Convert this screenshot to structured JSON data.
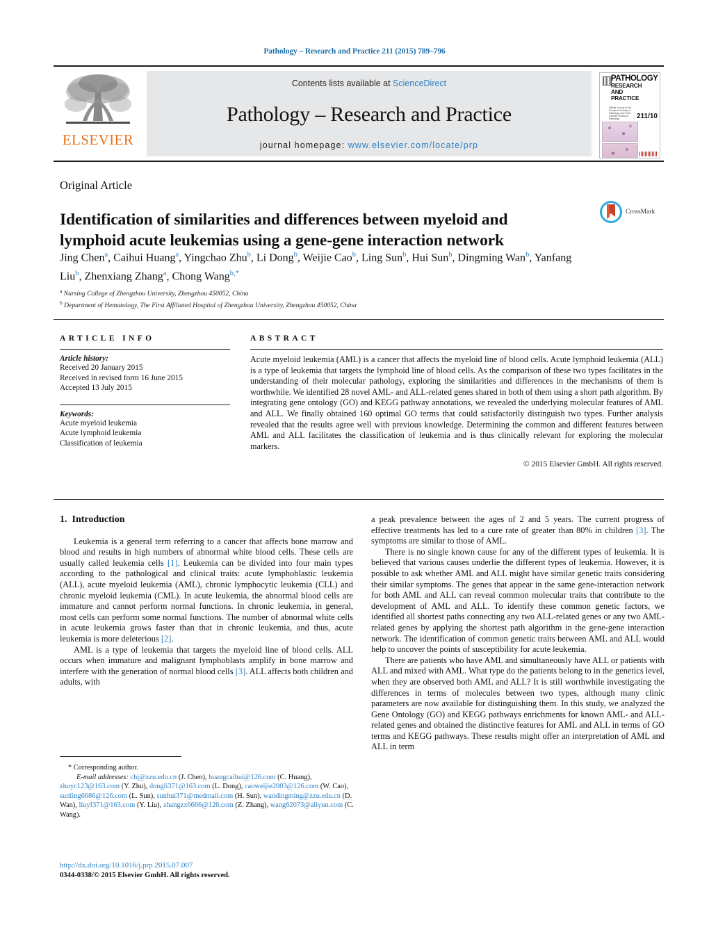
{
  "running_head": "Pathology – Research and Practice 211 (2015) 789–796",
  "masthead": {
    "publisher_logo_text": "ELSEVIER",
    "contents_prefix": "Contents lists available at ",
    "contents_link": "ScienceDirect",
    "journal_title": "Pathology – Research and Practice",
    "homepage_prefix": "journal homepage: ",
    "homepage_url": "www.elsevier.com/locate/prp",
    "cover": {
      "line1": "PATHOLOGY",
      "line2": "RESEARCH",
      "line2b": "AND",
      "line3": "PRACTICE",
      "volume": "211/10",
      "tiny_note": "Official Journal of the European Society of Pathology and of the German Society of Pathology"
    }
  },
  "article": {
    "type": "Original Article",
    "title": "Identification of similarities and differences between myeloid and lymphoid acute leukemias using a gene-gene interaction network",
    "crossmark_label": "CrossMark",
    "authors_html": "Jing Chen<sup>a</sup>, Caihui Huang<sup>a</sup>, Yingchao Zhu<sup>b</sup>, Li Dong<sup>b</sup>, Weijie Cao<sup>b</sup>, Ling Sun<sup>b</sup>, Hui Sun<sup>b</sup>, Dingming Wan<sup>b</sup>, Yanfang Liu<sup>b</sup>, Zhenxiang Zhang<sup>a</sup>, Chong Wang<sup>b,*</sup>",
    "affiliations": [
      "Nursing College of Zhengzhou University, Zhengzhou 450052, China",
      "Department of Hematology, The First Affiliated Hospital of Zhengzhou University, Zhengzhou 450052, China"
    ]
  },
  "info": {
    "heading": "ARTICLE INFO",
    "history_label": "Article history:",
    "history": [
      "Received 20 January 2015",
      "Received in revised form 16 June 2015",
      "Accepted 13 July 2015"
    ],
    "keywords_label": "Keywords:",
    "keywords": [
      "Acute myeloid leukemia",
      "Acute lymphoid leukemia",
      "Classification of leukemia"
    ]
  },
  "abstract": {
    "heading": "ABSTRACT",
    "text": "Acute myeloid leukemia (AML) is a cancer that affects the myeloid line of blood cells. Acute lymphoid leukemia (ALL) is a type of leukemia that targets the lymphoid line of blood cells. As the comparison of these two types facilitates in the understanding of their molecular pathology, exploring the similarities and differences in the mechanisms of them is worthwhile. We identified 28 novel AML- and ALL-related genes shared in both of them using a short path algorithm. By integrating gene ontology (GO) and KEGG pathway annotations, we revealed the underlying molecular features of AML and ALL. We finally obtained 160 optimal GO terms that could satisfactorily distinguish two types. Further analysis revealed that the results agree well with previous knowledge. Determining the common and different features between AML and ALL facilitates the classification of leukemia and is thus clinically relevant for exploring the molecular markers.",
    "copyright": "© 2015 Elsevier GmbH. All rights reserved."
  },
  "intro": {
    "number": "1.",
    "heading": "Introduction",
    "left_p1_a": "Leukemia is a general term referring to a cancer that affects bone marrow and blood and results in high numbers of abnormal white blood cells. These cells are usually called leukemia cells ",
    "left_p1_ref1": "[1]",
    "left_p1_b": ". Leukemia can be divided into four main types according to the pathological and clinical traits: acute lymphoblastic leukemia (ALL), acute myeloid leukemia (AML), chronic lymphocytic leukemia (CLL) and chronic myeloid leukemia (CML). In acute leukemia, the abnormal blood cells are immature and cannot perform normal functions. In chronic leukemia, in general, most cells can perform some normal functions. The number of abnormal white cells in acute leukemia grows faster than that in chronic leukemia, and thus, acute leukemia is more deleterious ",
    "left_p1_ref2": "[2]",
    "left_p1_c": ".",
    "left_p2_a": "AML is a type of leukemia that targets the myeloid line of blood cells. ALL occurs when immature and malignant lymphoblasts amplify in bone marrow and interfere with the generation of normal blood cells ",
    "left_p2_ref3": "[3]",
    "left_p2_b": ". ALL affects both children and adults, with",
    "right_p1_a": "a peak prevalence between the ages of 2 and 5 years. The current progress of effective treatments has led to a cure rate of greater than 80% in children ",
    "right_p1_ref3": "[3]",
    "right_p1_b": ". The symptoms are similar to those of AML.",
    "right_p2": "There is no single known cause for any of the different types of leukemia. It is believed that various causes underlie the different types of leukemia. However, it is possible to ask whether AML and ALL might have similar genetic traits considering their similar symptoms. The genes that appear in the same gene-interaction network for both AML and ALL can reveal common molecular traits that contribute to the development of AML and ALL. To identify these common genetic factors, we identified all shortest paths connecting any two ALL-related genes or any two AML-related genes by applying the shortest path algorithm in the gene-gene interaction network. The identification of common genetic traits between AML and ALL would help to uncover the points of susceptibility for acute leukemia.",
    "right_p3": "There are patients who have AML and simultaneously have ALL or patients with ALL and mixed with AML. What type do the patients belong to in the genetics level, when they are observed both AML and ALL? It is still worthwhile investigating the differences in terms of molecules between two types, although many clinic parameters are now available for distinguishing them. In this study, we analyzed the Gene Ontology (GO) and KEGG pathways enrichments for known AML- and ALL-related genes and obtained the distinctive features for AML and ALL in terms of GO terms and KEGG pathways. These results might offer an interpretation of AML and ALL in term"
  },
  "footnotes": {
    "corresponding": "* Corresponding author.",
    "email_label": "E-mail addresses:",
    "emails": [
      {
        "address": "chj@zzu.edu.cn",
        "person": "(J. Chen),"
      },
      {
        "address": "huangcaihui@126.com",
        "person": "(C. Huang),"
      },
      {
        "address": "zhuyc123@163.com",
        "person": "(Y. Zhu),"
      },
      {
        "address": "dongli371@163.com",
        "person": "(L. Dong),"
      },
      {
        "address": "caoweijie2003@126.com",
        "person": "(W. Cao),"
      },
      {
        "address": "sunling6686@126.com",
        "person": "(L. Sun),"
      },
      {
        "address": "sunhui371@medmail.com",
        "person": "(H. Sun),"
      },
      {
        "address": "wandingming@zzu.edu.cn",
        "person": "(D. Wan),"
      },
      {
        "address": "liuyf371@163.com",
        "person": "(Y. Liu),"
      },
      {
        "address": "zhangzx6666@126.com",
        "person": "(Z. Zhang),"
      },
      {
        "address": "wang62073@aliyun.com",
        "person": "(C. Wang)."
      }
    ],
    "doi": "http://dx.doi.org/10.1016/j.prp.2015.07.007",
    "issn": "0344-0338/© 2015 Elsevier GmbH. All rights reserved."
  },
  "colors": {
    "link": "#2b7fc4",
    "elsevier_orange": "#e8721c",
    "band_gray": "#e6e7e8"
  }
}
